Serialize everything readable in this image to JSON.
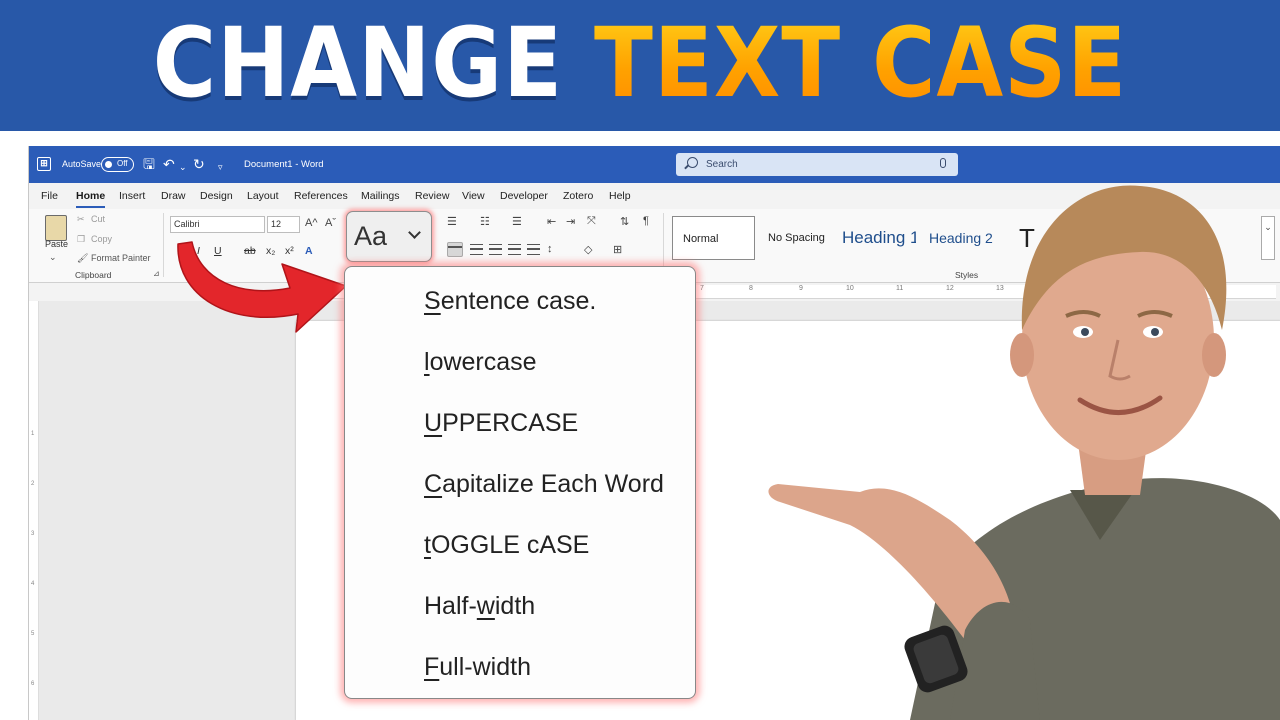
{
  "banner": {
    "title_part1": "CHANGE",
    "title_part2": "TEXT CASE",
    "colors": {
      "background": "#2858a8",
      "white": "#ffffff",
      "orange": "#ffa200"
    }
  },
  "word": {
    "titlebar": {
      "autosave_label": "AutoSave",
      "autosave_state": "Off",
      "doc_title": "Document1  -  Word",
      "search_placeholder": "Search"
    },
    "menu": [
      "File",
      "Home",
      "Insert",
      "Draw",
      "Design",
      "Layout",
      "References",
      "Mailings",
      "Review",
      "View",
      "Developer",
      "Zotero",
      "Help"
    ],
    "active_menu": "Home",
    "clipboard": {
      "paste": "Paste",
      "cut": "Cut",
      "copy": "Copy",
      "format_painter": "Format Painter",
      "group_label": "Clipboard"
    },
    "font": {
      "font_name": "Calibri",
      "font_size": "12",
      "bold": "B",
      "italic": "I",
      "underline": "U",
      "strike": "ab",
      "subscript": "x₂",
      "superscript": "x²",
      "grow": "A^",
      "shrink": "Aˇ",
      "change_case": "Aa"
    },
    "styles": {
      "normal": "Normal",
      "no_spacing": "No Spacing",
      "heading1": "Heading 1",
      "heading2": "Heading 2",
      "title": "T",
      "group_label": "Styles"
    },
    "ruler_ticks": [
      "7",
      "8",
      "9",
      "10",
      "11",
      "12",
      "13"
    ],
    "vruler_ticks": [
      "1",
      "2",
      "3",
      "4",
      "5",
      "6"
    ],
    "accent": "#2b5cb8"
  },
  "dropdown": {
    "items": [
      {
        "mnemonic": "S",
        "rest": "entence case.",
        "prefix": ""
      },
      {
        "mnemonic": "l",
        "rest": "owercase",
        "prefix": ""
      },
      {
        "mnemonic": "U",
        "rest": "PPERCASE",
        "prefix": ""
      },
      {
        "mnemonic": "C",
        "rest": "apitalize Each Word",
        "prefix": ""
      },
      {
        "mnemonic": "t",
        "rest": "OGGLE cASE",
        "prefix": ""
      },
      {
        "mnemonic": "w",
        "rest": "idth",
        "prefix": "Half-"
      },
      {
        "mnemonic": "F",
        "rest": "ull-width",
        "prefix": ""
      }
    ]
  },
  "arrow_color": "#e3262b"
}
